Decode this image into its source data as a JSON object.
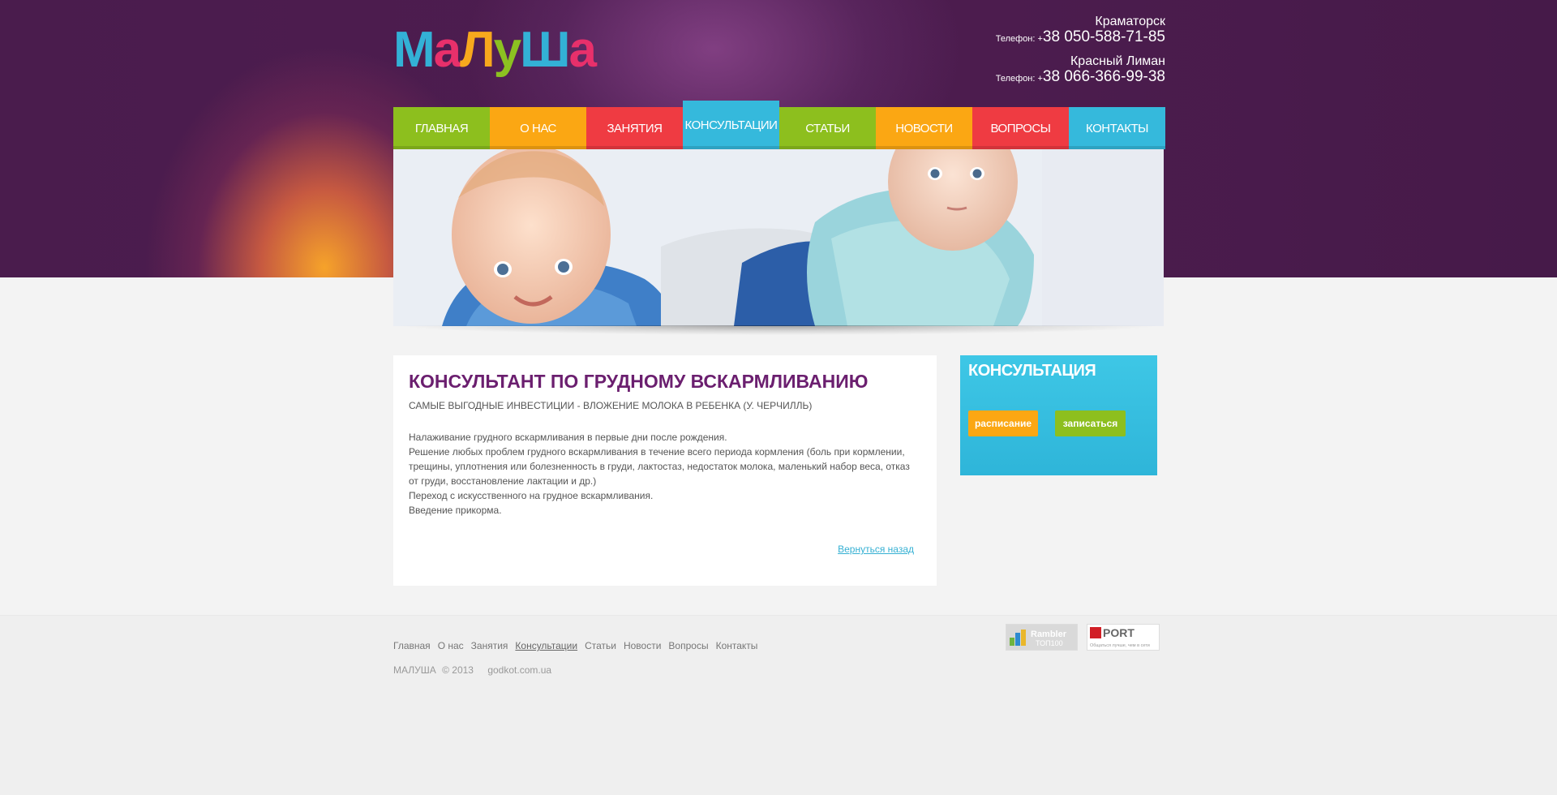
{
  "brand": {
    "letters": [
      {
        "ch": "М",
        "color": "#33b1d6"
      },
      {
        "ch": "а",
        "color": "#e8306b"
      },
      {
        "ch": "Л",
        "color": "#f7a81d"
      },
      {
        "ch": "у",
        "color": "#8cc121"
      },
      {
        "ch": "Ш",
        "color": "#33b1d6"
      },
      {
        "ch": "а",
        "color": "#e8306b"
      }
    ]
  },
  "contacts": [
    {
      "city": "Краматорск",
      "phone_label": "Телефон: +",
      "phone": "38 050-588-71-85"
    },
    {
      "city": "Красный Лиман",
      "phone_label": "Телефон: +",
      "phone": "38 066-366-99-38"
    }
  ],
  "nav": [
    {
      "label": "Главная",
      "color": "#8dbf1e",
      "active": false
    },
    {
      "label": "О нас",
      "color": "#fba713",
      "active": false
    },
    {
      "label": "Занятия",
      "color": "#ef3b42",
      "active": false
    },
    {
      "label": "Консультации",
      "color": "#35b9dc",
      "active": true
    },
    {
      "label": "Статьи",
      "color": "#8dbf1e",
      "active": false
    },
    {
      "label": "Новости",
      "color": "#fba713",
      "active": false
    },
    {
      "label": "Вопросы",
      "color": "#ef3b42",
      "active": false
    },
    {
      "label": "Контакты",
      "color": "#35b9dc",
      "active": false
    }
  ],
  "main": {
    "title": "Консультант по грудному вскармливанию",
    "subtitle": "Самые выгодные инвестиции - вложение молока в ребенка (У. Черчилль)",
    "paragraphs": [
      "Налаживание грудного вскармливания в первые дни после рождения.",
      "Решение любых проблем грудного вскармливания в течение всего периода кормления (боль при кормлении, трещины, уплотнения или болезненность в груди, лактостаз, недостаток молока, маленький набор веса, отказ от груди, восстановление лактации и др.)",
      "Переход с искусственного на грудное вскармливания.",
      "Введение прикорма."
    ],
    "back_link": "Вернуться назад"
  },
  "sidebar": {
    "title": "Консультация",
    "btn_schedule": "расписание",
    "btn_schedule_color": "#fba713",
    "btn_signup": "записаться",
    "btn_signup_color": "#8dbf1e"
  },
  "footer": {
    "nav": [
      "Главная",
      "О нас",
      "Занятия",
      "Консультации",
      "Статьи",
      "Новости",
      "Вопросы",
      "Контакты"
    ],
    "current": "Консультации",
    "brand": "МАЛУША",
    "year": "© 2013",
    "credit": "godkot.com.ua"
  },
  "counters": {
    "rambler_name": "Rambler",
    "rambler_sub": "ТОП100",
    "port_name": "PORT",
    "port_sub": "Общаться лучше, чем в сети"
  }
}
